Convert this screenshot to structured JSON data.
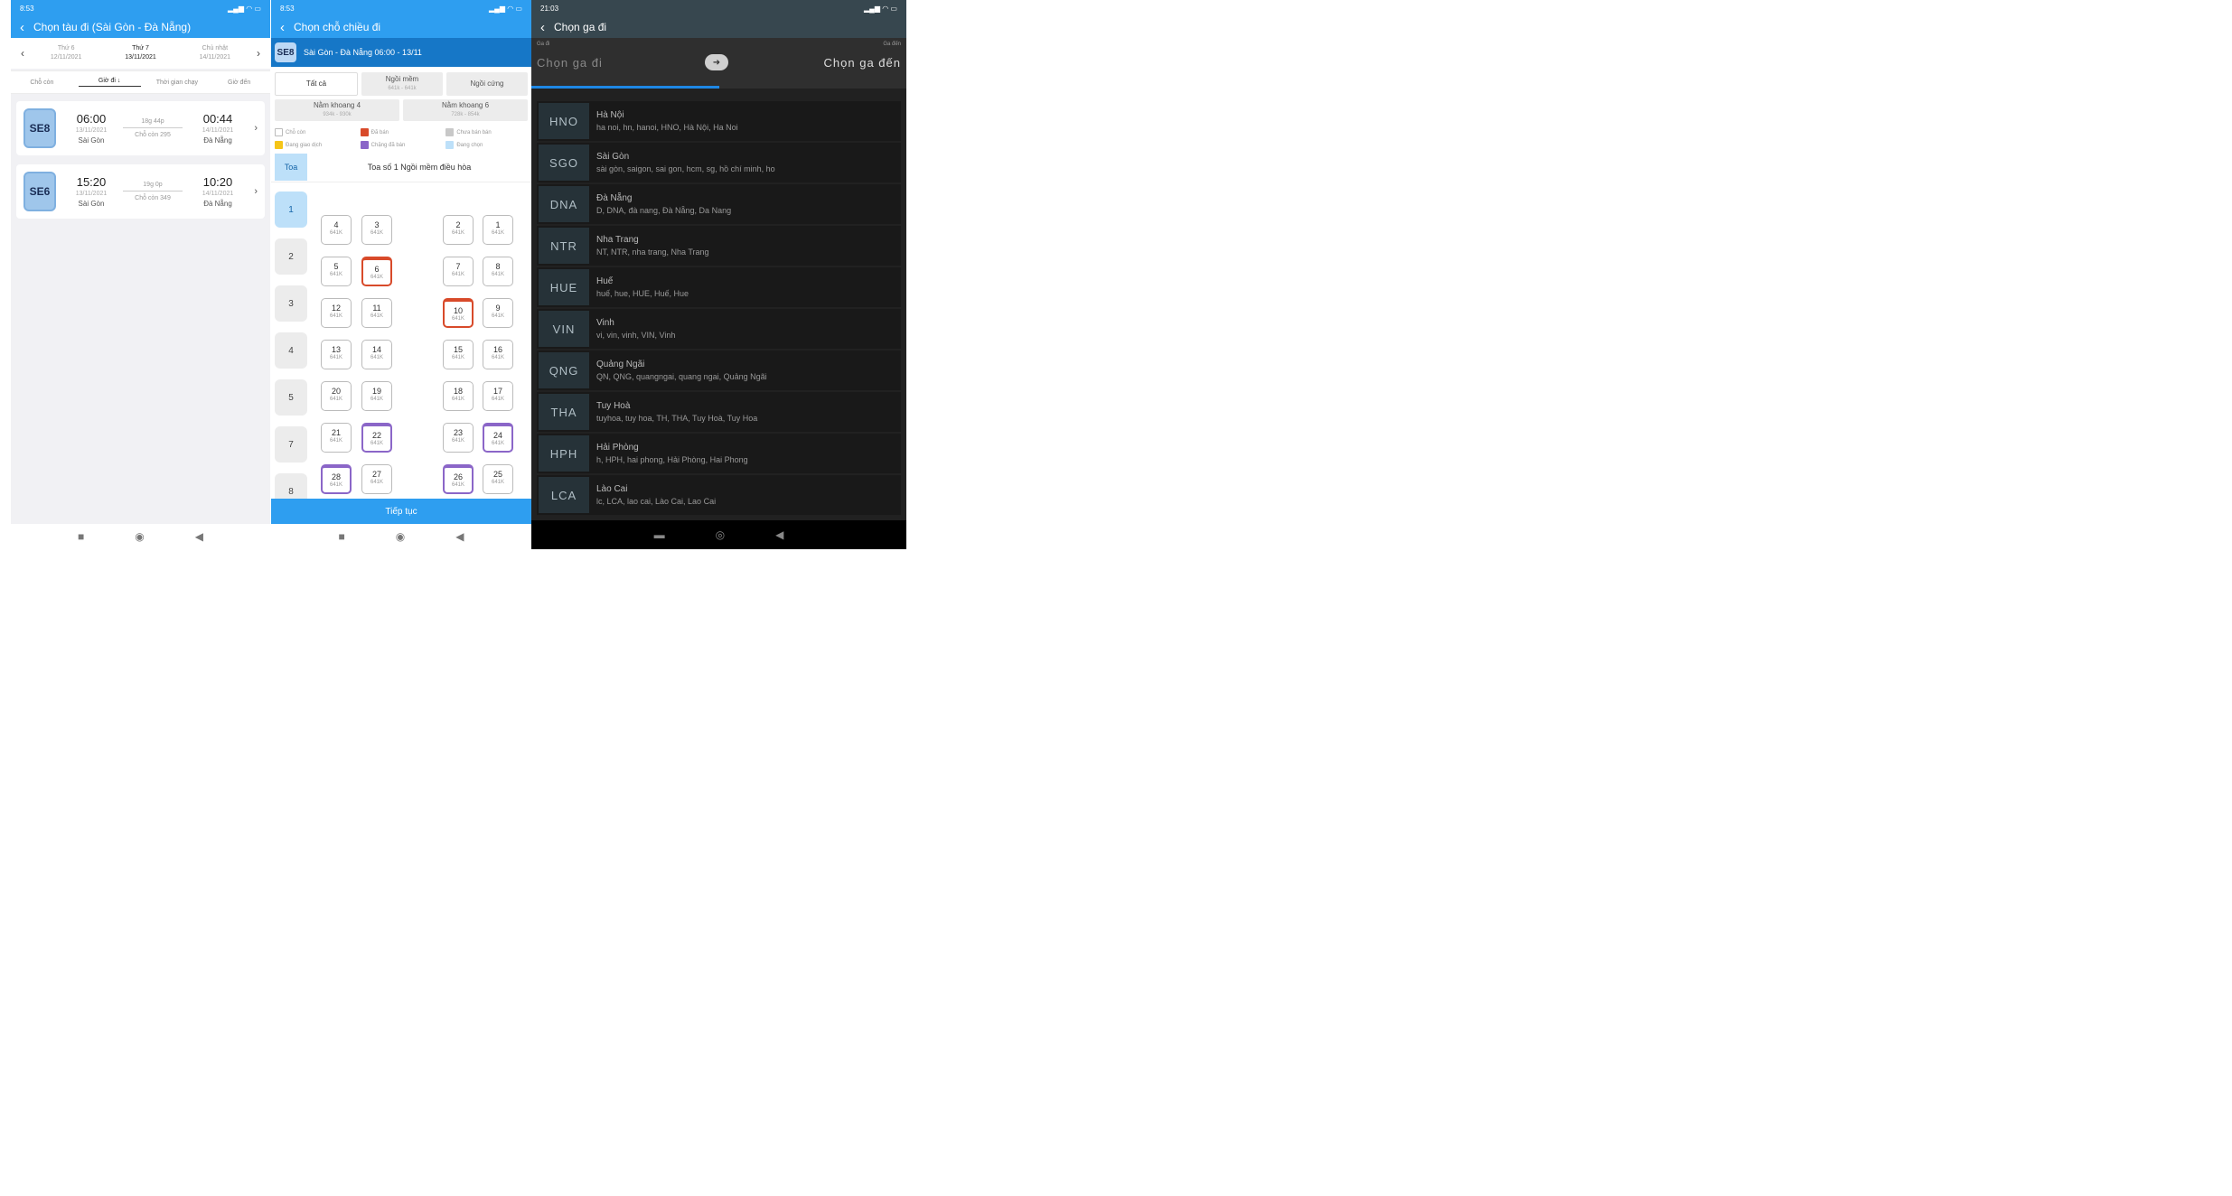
{
  "panel1": {
    "status_time": "8:53",
    "title": "Chọn tàu đi (Sài Gòn - Đà Nẵng)",
    "dates": [
      {
        "day": "Thứ 6",
        "date": "12/11/2021"
      },
      {
        "day": "Thứ 7",
        "date": "13/11/2021"
      },
      {
        "day": "Chủ nhật",
        "date": "14/11/2021"
      }
    ],
    "sort": [
      "Chỗ còn",
      "Giờ đi ↓",
      "Thời gian chạy",
      "Giờ đến"
    ],
    "trains": [
      {
        "code": "SE8",
        "dep_time": "06:00",
        "dep_date": "13/11/2021",
        "dep_station": "Sài Gòn",
        "duration": "18g 44p",
        "seats": "Chỗ còn 295",
        "arr_time": "00:44",
        "arr_date": "14/11/2021",
        "arr_station": "Đà Nẵng"
      },
      {
        "code": "SE6",
        "dep_time": "15:20",
        "dep_date": "13/11/2021",
        "dep_station": "Sài Gòn",
        "duration": "19g 0p",
        "seats": "Chỗ còn 349",
        "arr_time": "10:20",
        "arr_date": "14/11/2021",
        "arr_station": "Đà Nẵng"
      }
    ]
  },
  "panel2": {
    "status_time": "8:53",
    "title": "Chọn chỗ chiều đi",
    "route_code": "SE8",
    "route": "Sài Gòn - Đà Nẵng 06:00 - 13/11",
    "tabs": [
      {
        "label": "Tất cả",
        "sub": ""
      },
      {
        "label": "Ngồi mềm",
        "sub": "641k - 641k"
      },
      {
        "label": "Ngồi cứng",
        "sub": ""
      }
    ],
    "tabs2": [
      {
        "label": "Nằm khoang 4",
        "sub": "934k - 930k"
      },
      {
        "label": "Nằm khoang 6",
        "sub": "728k - 854k"
      }
    ],
    "legend": [
      {
        "label": "Chỗ còn",
        "color": "#ffffff"
      },
      {
        "label": "Đã bán",
        "color": "#d84a2a"
      },
      {
        "label": "Chưa bán bán",
        "color": "#c8c8c8"
      },
      {
        "label": "Đang giao dịch",
        "color": "#f5c518"
      },
      {
        "label": "Chặng đã bán",
        "color": "#8b66c8"
      },
      {
        "label": "Đang chọn",
        "color": "#bde0f9"
      }
    ],
    "toa_label": "Toa",
    "coach_title": "Toa số 1 Ngồi mềm điều hòa",
    "coaches": [
      "1",
      "2",
      "3",
      "4",
      "5",
      "7",
      "8"
    ],
    "price": "641K",
    "seat_rows": [
      [
        "4",
        "3",
        "2",
        "1"
      ],
      [
        "5",
        "6",
        "7",
        "8"
      ],
      [
        "12",
        "11",
        "10",
        "9"
      ],
      [
        "13",
        "14",
        "15",
        "16"
      ],
      [
        "20",
        "19",
        "18",
        "17"
      ],
      [
        "21",
        "22",
        "23",
        "24"
      ],
      [
        "28",
        "27",
        "26",
        "25"
      ]
    ],
    "continue": "Tiếp tục"
  },
  "panel3": {
    "status_time": "21:03",
    "title": "Chọn ga đi",
    "from_small": "Ga đi",
    "from_placeholder": "Chọn ga đi",
    "to_small": "Ga đến",
    "to_placeholder": "Chọn ga đến",
    "stations": [
      {
        "code": "HNO",
        "name": "Hà Nội",
        "aliases": "ha noi, hn, hanoi, HNO, Hà Nội, Ha Noi"
      },
      {
        "code": "SGO",
        "name": "Sài Gòn",
        "aliases": "sài gòn, saigon, sai gon, hcm, sg, hồ chí minh, ho"
      },
      {
        "code": "DNA",
        "name": "Đà Nẵng",
        "aliases": "D, DNA, đà nang, Đà Nẵng, Da Nang"
      },
      {
        "code": "NTR",
        "name": "Nha Trang",
        "aliases": "NT, NTR, nha trang, Nha Trang"
      },
      {
        "code": "HUE",
        "name": "Huế",
        "aliases": "huế, hue, HUE, Huế, Hue"
      },
      {
        "code": "VIN",
        "name": "Vinh",
        "aliases": "vi, vin, vinh, VIN, Vinh"
      },
      {
        "code": "QNG",
        "name": "Quảng Ngãi",
        "aliases": "QN, QNG, quangngai, quang ngai, Quảng Ngãi"
      },
      {
        "code": "THA",
        "name": "Tuy Hoà",
        "aliases": "tuyhoa, tuy hoa, TH, THA, Tuy Hoà, Tuy Hoa"
      },
      {
        "code": "HPH",
        "name": "Hải Phòng",
        "aliases": "h, HPH, hai phong, Hải Phòng, Hai Phong"
      },
      {
        "code": "LCA",
        "name": "Lào Cai",
        "aliases": "lc, LCA, lao cai, Lào Cai, Lao Cai"
      }
    ]
  }
}
